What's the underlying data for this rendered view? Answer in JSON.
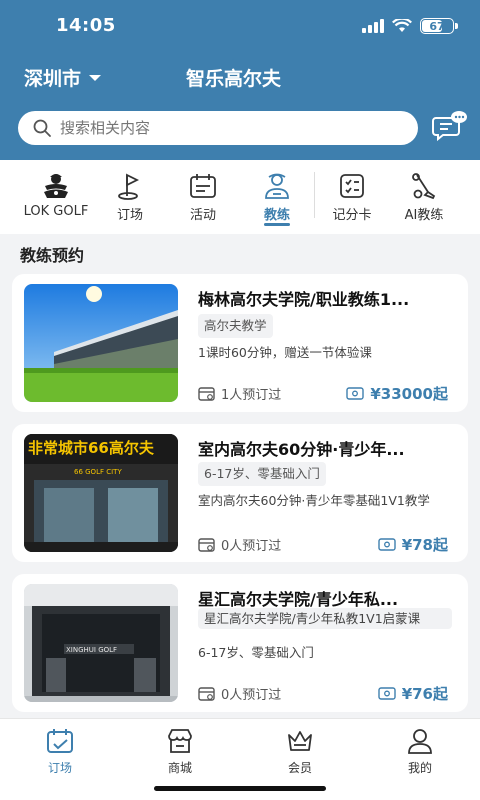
{
  "status_bar": {
    "time": "14:05",
    "battery": "67"
  },
  "header": {
    "city": "深圳市",
    "title": "智乐高尔夫"
  },
  "search": {
    "placeholder": "搜索相关内容"
  },
  "nav": {
    "items": [
      {
        "label": "LOK GOLF",
        "icon": "golfer-icon"
      },
      {
        "label": "订场",
        "icon": "flag-icon"
      },
      {
        "label": "活动",
        "icon": "calendar-icon"
      },
      {
        "label": "教练",
        "icon": "coach-icon",
        "active": true
      },
      {
        "label": "记分卡",
        "icon": "scorecard-icon"
      },
      {
        "label": "AI教练",
        "icon": "golf-club-icon"
      }
    ]
  },
  "section": {
    "title": "教练预约"
  },
  "cards": [
    {
      "title": "梅林高尔夫学院/职业教练1...",
      "tag": "高尔夫教学",
      "desc": "1课时60分钟，赠送一节体验课",
      "booked": "1人预订过",
      "price": "¥33000起"
    },
    {
      "title": "室内高尔夫60分钟·青少年...",
      "tag": "6-17岁、零基础入门",
      "desc": "室内高尔夫60分钟·青少年零基础1V1教学",
      "booked": "0人预订过",
      "price": "¥78起",
      "sign": "非常城市66高尔夫",
      "sign_sub": "66 GOLF CITY"
    },
    {
      "title": "星汇高尔夫学院/青少年私...",
      "tag": "星汇高尔夫学院/青少年私教1V1启蒙课",
      "desc": "6-17岁、零基础入门",
      "booked": "0人预订过",
      "price": "¥76起",
      "sign": "XINGHUI GOLF"
    }
  ],
  "tabbar": {
    "items": [
      {
        "label": "订场",
        "icon": "calendar-check-icon",
        "active": true
      },
      {
        "label": "商城",
        "icon": "store-icon"
      },
      {
        "label": "会员",
        "icon": "crown-icon"
      },
      {
        "label": "我的",
        "icon": "user-icon"
      }
    ]
  },
  "colors": {
    "primary": "#3e7fae",
    "background": "#f2f3f5"
  }
}
